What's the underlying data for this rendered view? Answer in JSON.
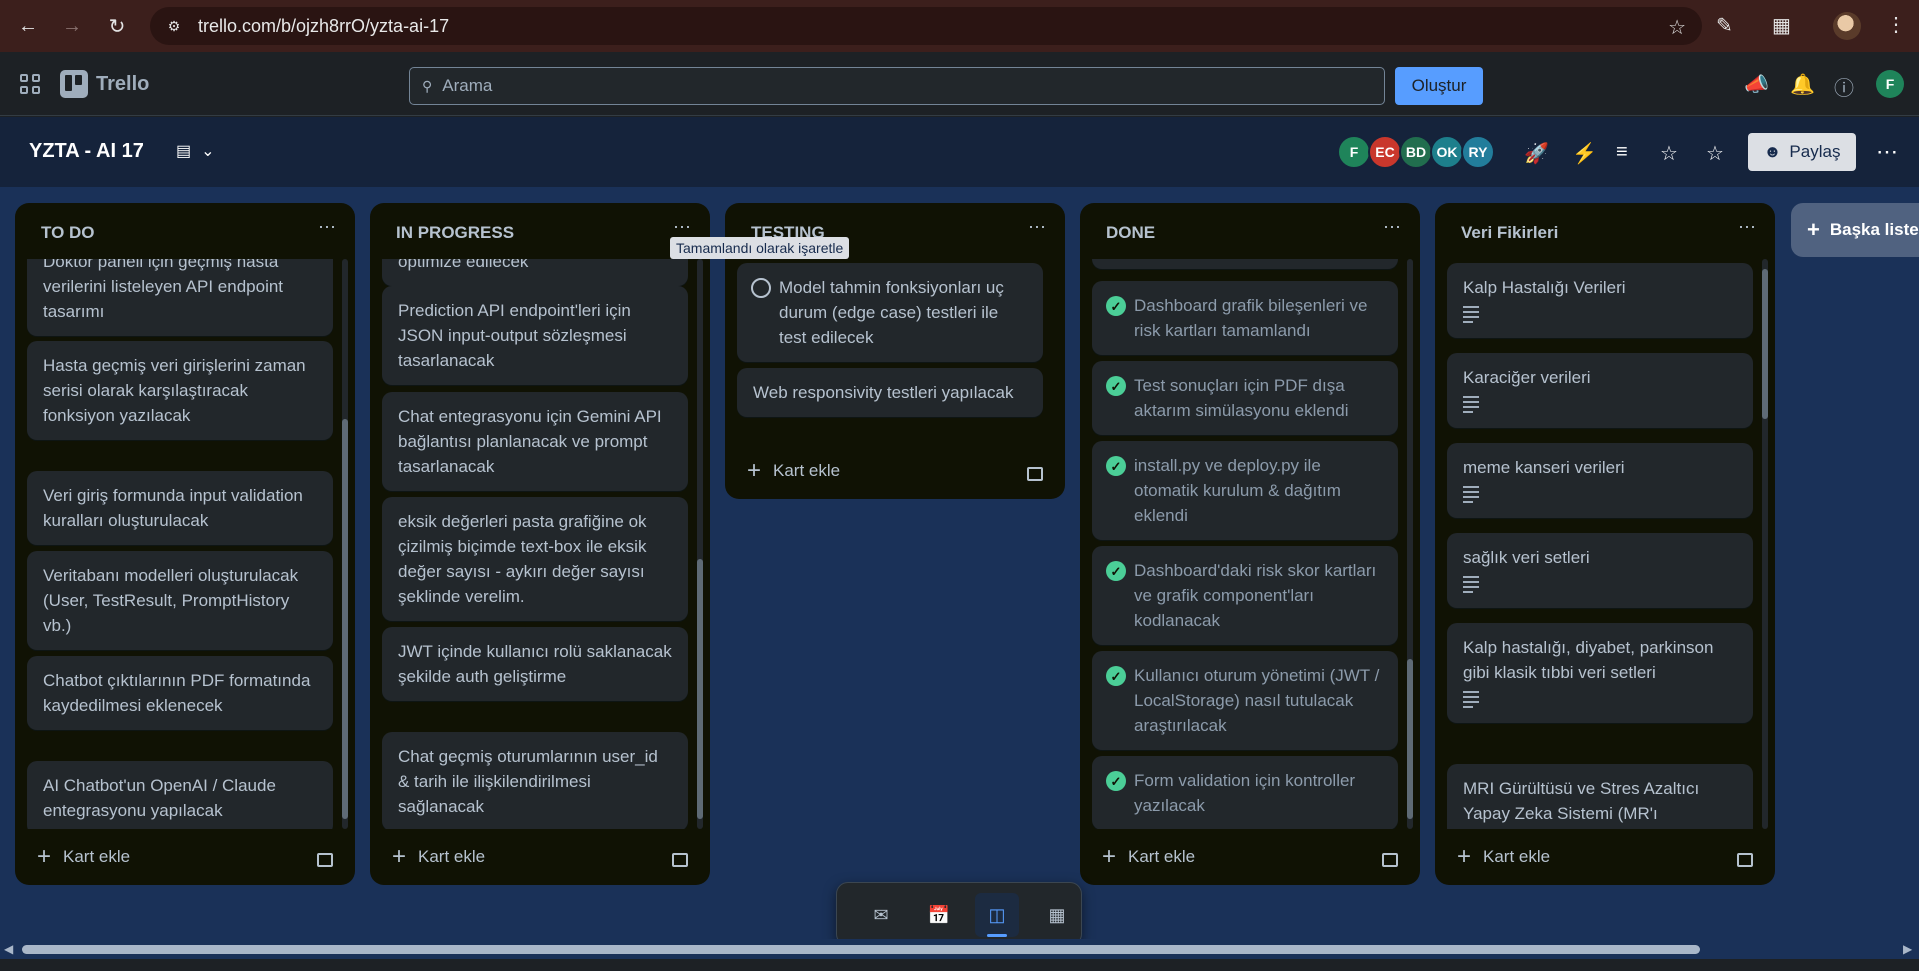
{
  "browser": {
    "url": "trello.com/b/ojzh8rrO/yzta-ai-17"
  },
  "header": {
    "logo_text": "Trello",
    "search_placeholder": "Arama",
    "create_label": "Oluştur",
    "user_initial": "F"
  },
  "board": {
    "title": "YZTA - AI 17",
    "members": [
      {
        "initials": "F",
        "color": "#1f845a"
      },
      {
        "initials": "EC",
        "color": "#c9372c"
      },
      {
        "initials": "BD",
        "color": "#216e4e"
      },
      {
        "initials": "OK",
        "color": "#1d7f8c"
      },
      {
        "initials": "RY",
        "color": "#227d9b"
      }
    ],
    "share_label": "Paylaş"
  },
  "tooltip": "Tamamlandı olarak işaretle",
  "lists": [
    {
      "title": "TO DO",
      "cards": [
        "Doktor paneli için geçmiş hasta verilerini listeleyen API endpoint tasarımı",
        "Hasta geçmiş veri girişlerini zaman serisi olarak karşılaştıracak fonksiyon yazılacak",
        "Veri giriş formunda input validation kuralları oluşturulacak",
        "Veritabanı modelleri oluşturulacak (User, TestResult, PromptHistory vb.)",
        "Chatbot çıktılarının PDF formatında kaydedilmesi eklenecek",
        "AI Chatbot'un OpenAI / Claude entegrasyonu yapılacak"
      ],
      "add_label": "Kart ekle"
    },
    {
      "title": "IN PROGRESS",
      "cards": [
        "optimize edilecek",
        "Prediction API endpoint'leri için JSON input-output sözleşmesi tasarlanacak",
        "Chat entegrasyonu için Gemini API bağlantısı planlanacak ve prompt tasarlanacak",
        "eksik değerleri pasta grafiğine ok çizilmiş biçimde text-box ile eksik değer sayısı - aykırı değer sayısı şeklinde verelim.",
        "JWT içinde kullanıcı rolü saklanacak şekilde auth geliştirme",
        "Chat geçmiş oturumlarının user_id & tarih ile ilişkilendirilmesi sağlanacak"
      ],
      "add_label": "Kart ekle"
    },
    {
      "title": "TESTING",
      "cards": [
        "Model tahmin fonksiyonları uç durum (edge case) testleri ile test edilecek",
        "Web responsivity testleri yapılacak"
      ],
      "add_label": "Kart ekle"
    },
    {
      "title": "DONE",
      "cards": [
        "Dashboard grafik bileşenleri ve risk kartları tamamlandı",
        "Test sonuçları için PDF dışa aktarım simülasyonu eklendi",
        "install.py ve deploy.py ile otomatik kurulum & dağıtım eklendi",
        "Dashboard'daki risk skor kartları ve grafik component'ları kodlanacak",
        "Kullanıcı oturum yönetimi (JWT / LocalStorage) nasıl tutulacak araştırılacak",
        "Form validation için kontroller yazılacak"
      ],
      "add_label": "Kart ekle"
    },
    {
      "title": "Veri Fikirleri",
      "cards": [
        "Kalp Hastalığı Verileri",
        "Karaciğer verileri",
        "meme kanseri verileri",
        "sağlık veri setleri",
        "Kalp hastalığı, diyabet, parkinson gibi klasik tıbbi veri setleri",
        "MRI Gürültüsü ve Stres Azaltıcı Yapay Zeka Sistemi (MR'ı"
      ],
      "add_label": "Kart ekle"
    }
  ],
  "add_list_label": "Başka liste",
  "icons": {
    "back": "back-arrow-icon",
    "forward": "forward-arrow-icon",
    "reload": "reload-icon",
    "star": "star-icon",
    "apps": "apps-grid-icon",
    "search": "search-icon",
    "megaphone": "megaphone-icon",
    "bell": "bell-icon",
    "help": "help-icon"
  }
}
